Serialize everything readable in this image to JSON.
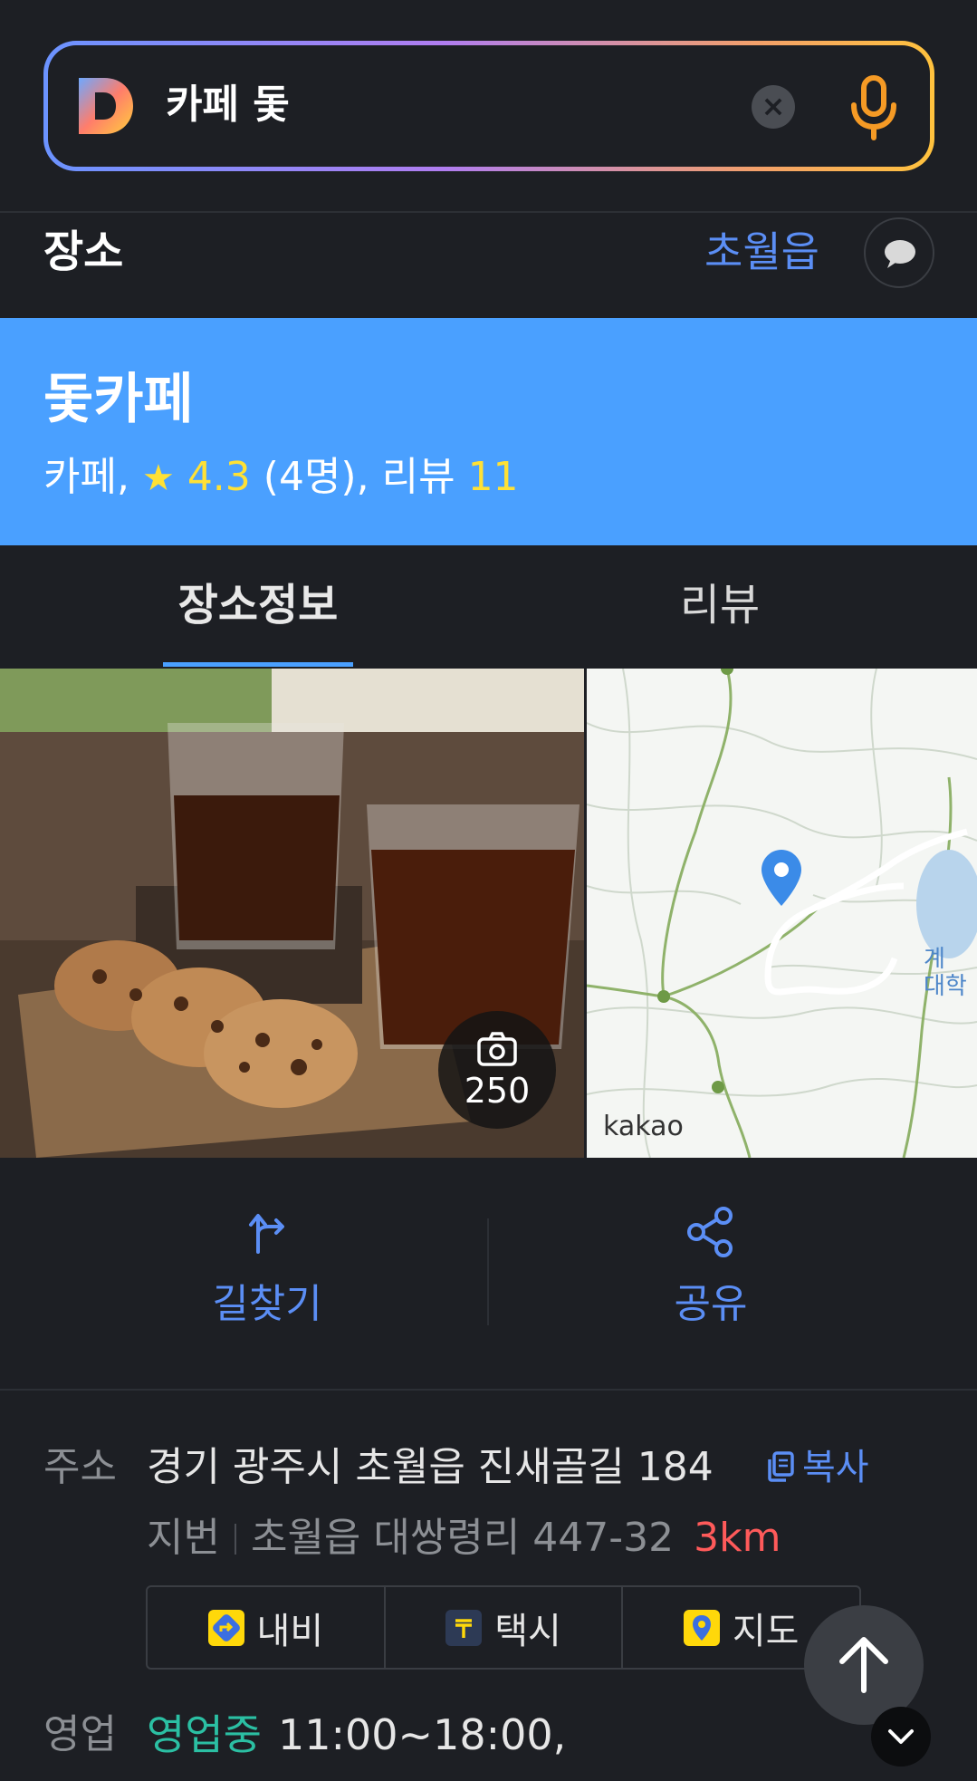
{
  "search": {
    "query": "카페 돛",
    "logo": "daum-d-logo",
    "clear_icon": "×"
  },
  "section": {
    "title": "장소",
    "region": "초월읍"
  },
  "place": {
    "name": "돛카페",
    "category": "카페,",
    "rating": "4.3",
    "rating_count": "(4명),",
    "review_label": "리뷰",
    "review_count": "11"
  },
  "tabs": [
    {
      "label": "장소정보",
      "active": true
    },
    {
      "label": "리뷰",
      "active": false
    }
  ],
  "photo": {
    "count": "250"
  },
  "map": {
    "brand": "kakao",
    "label": "계\n대학"
  },
  "actions": {
    "directions": "길찾기",
    "share": "공유"
  },
  "address": {
    "label": "주소",
    "road": "경기 광주시 초월읍 진새골길 184",
    "copy": "복사",
    "jibun_label": "지번",
    "jibun": "초월읍 대쌍령리 447-32",
    "distance": "3km"
  },
  "nav_buttons": {
    "navi": "내비",
    "taxi": "택시",
    "map": "지도"
  },
  "hours": {
    "label": "영업",
    "status": "영업중",
    "time": "11:00~18:00,"
  },
  "colors": {
    "accent_blue": "#4aa0ff",
    "link_blue": "#5b8ef5",
    "rating_yellow": "#ffe135",
    "open_green": "#2bbfa3",
    "distance_red": "#ff5a5a",
    "background": "#1d1f24"
  }
}
